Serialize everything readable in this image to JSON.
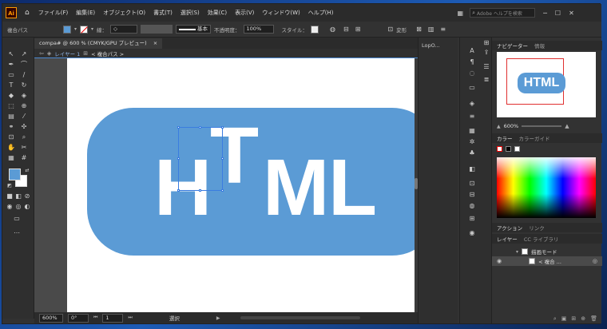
{
  "menu": [
    "ファイル(F)",
    "編集(E)",
    "オブジェクト(O)",
    "書式(T)",
    "選択(S)",
    "効果(C)",
    "表示(V)",
    "ウィンドウ(W)",
    "ヘルプ(H)"
  ],
  "search": {
    "placeholder": "Adobe ヘルプを検索"
  },
  "control": {
    "path_label": "複合パス",
    "stroke_label": "線：",
    "brush": "基本",
    "opacity_label": "不透明度：",
    "opacity": "100%",
    "style_label": "スタイル：",
    "transform": "変形"
  },
  "tabs": {
    "doc": "compa# @ 600 % (CMYK/GPU プレビュー)",
    "close": "×",
    "side": "Lop...",
    "side_tab": "LopO..."
  },
  "crumbs": {
    "layer": "レイヤー 1",
    "path": "< 複合パス >"
  },
  "art": {
    "l1": "H",
    "l2": "T",
    "l3": "M",
    "l4": "L"
  },
  "status": {
    "zoom": "600%",
    "rot": "0°",
    "page": "1",
    "mode": "選択"
  },
  "navigator": {
    "tab1": "ナビゲーター",
    "tab2": "情報",
    "zoom": "600%",
    "thumb_text": "HTML"
  },
  "color": {
    "tab1": "カラー",
    "tab2": "カラーガイド"
  },
  "action": {
    "tab1": "アクション",
    "tab2": "リンク"
  },
  "layers": {
    "tab1": "レイヤー",
    "tab2": "CC ライブラリ",
    "row1": "描画モード",
    "row2": "< 複合 ..."
  },
  "colors": {
    "accent": "#5b9bd5",
    "artboard": "#ffffff",
    "select": "#3b7de0"
  }
}
